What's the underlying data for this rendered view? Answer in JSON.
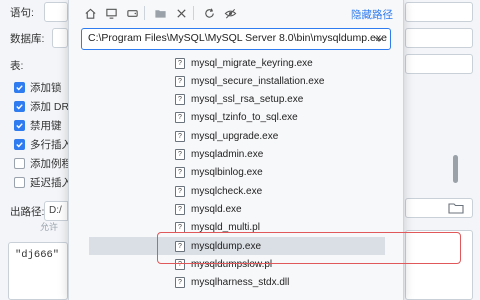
{
  "background": {
    "labels": {
      "database_type": "语句:",
      "database": "数据库:",
      "table": "表:",
      "output_path": "出路径:"
    },
    "options": [
      {
        "label": "添加锁",
        "checked": true
      },
      {
        "label": "添加 DR",
        "checked": true
      },
      {
        "label": "禁用键",
        "checked": true
      },
      {
        "label": "多行插入",
        "checked": true
      },
      {
        "label": "添加例程",
        "checked": false
      },
      {
        "label": "延迟插入",
        "checked": false
      }
    ],
    "output_path_value": "D:/",
    "hint": "允许",
    "textarea_value": "\"dj666\""
  },
  "picker": {
    "hide_path_label": "隐藏路径",
    "path_value": "C:\\Program Files\\MySQL\\MySQL Server 8.0\\bin\\mysqldump.exe",
    "file_icon_glyph": "?",
    "files": [
      "mysql_migrate_keyring.exe",
      "mysql_secure_installation.exe",
      "mysql_ssl_rsa_setup.exe",
      "mysql_tzinfo_to_sql.exe",
      "mysql_upgrade.exe",
      "mysqladmin.exe",
      "mysqlbinlog.exe",
      "mysqlcheck.exe",
      "mysqld.exe",
      "mysqld_multi.pl",
      "mysqldump.exe",
      "mysqldumpslow.pl",
      "mysqlharness_stdx.dll"
    ],
    "selected_index": 10
  },
  "colors": {
    "accent": "#2f7bf0",
    "highlight": "#e0585a"
  }
}
